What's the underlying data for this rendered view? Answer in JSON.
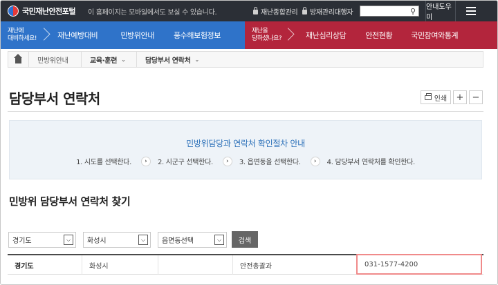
{
  "header": {
    "logo_text": "국민재난안전포털",
    "mobile_note": "이 홈페이지는 모바일에서도 보실 수 있습니다.",
    "links": [
      "재난종합관리",
      "방재관리대행자"
    ],
    "search_placeholder": "",
    "helper_label": "안내도우미"
  },
  "nav": {
    "blue_caption": "재난에\n대비하세요!",
    "blue_items": [
      "재난예방대비",
      "민방위안내",
      "풍수해보험정보"
    ],
    "red_caption": "재난을\n당하셨나요?",
    "red_items": [
      "재난심리상담",
      "안전현황",
      "국민참여와통계"
    ],
    "colors": {
      "blue": "#2f73c9",
      "red": "#b3253c"
    }
  },
  "breadcrumb": {
    "items": [
      "민방위안내",
      "교육·훈련",
      "담당부서 연락처"
    ]
  },
  "page": {
    "title": "담당부서 연락처",
    "print_label": "인쇄",
    "zoom_in_label": "+",
    "zoom_out_label": "−"
  },
  "guide": {
    "title": "민방위담당과 연락처 확인절차 안내",
    "steps": [
      "1. 시도를 선택한다.",
      "2. 시군구 선택한다.",
      "3. 읍면동을 선택한다.",
      "4. 담당부서 연락처를 확인한다."
    ]
  },
  "finder": {
    "title": "민방위 담당부서 연락처 찾기",
    "selects": [
      "경기도",
      "화성시",
      "읍면동선택"
    ],
    "search_label": "검색"
  },
  "result": {
    "cells": [
      "경기도",
      "화성시",
      "",
      "안전총괄과",
      "031-1577-4200"
    ]
  }
}
